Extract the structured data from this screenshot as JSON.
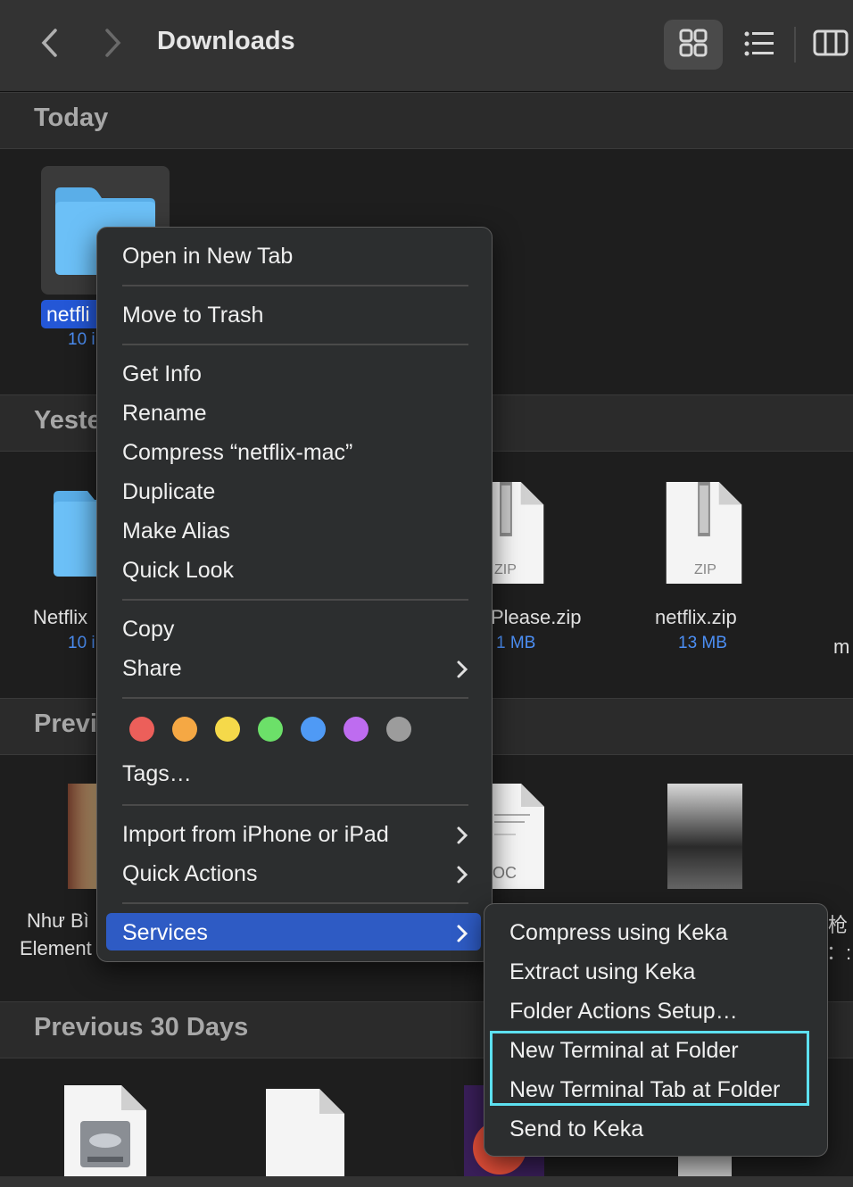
{
  "window": {
    "title": "Downloads"
  },
  "toolbar": {
    "back_icon": "chevron-left-icon",
    "forward_icon": "chevron-right-icon",
    "views": [
      "grid-view-icon",
      "list-view-icon",
      "column-view-icon"
    ]
  },
  "sections": {
    "today": "Today",
    "yesterday": "Yeste",
    "previous7": "Previ",
    "previous30": "Previous 30 Days"
  },
  "items": {
    "today_folder": {
      "name": "netfli",
      "size": "10 i"
    },
    "yesterday_folder": {
      "name": "Netflix",
      "size": "10 i"
    },
    "please_zip": {
      "name": "Please.zip",
      "size": "1 MB",
      "badge": "ZIP"
    },
    "netflix_zip": {
      "name": "netflix.zip",
      "size": "13 MB",
      "badge": "ZIP"
    },
    "edge_m": "m",
    "book1": {
      "line1": "Như Bì",
      "line2": "Element"
    },
    "doc_badge": "OC",
    "edge_cjk": "枪",
    "edge_colon": "：:"
  },
  "context_menu": {
    "open_new_tab": "Open in New Tab",
    "move_trash": "Move to Trash",
    "get_info": "Get Info",
    "rename": "Rename",
    "compress": "Compress “netflix-mac”",
    "duplicate": "Duplicate",
    "make_alias": "Make Alias",
    "quick_look": "Quick Look",
    "copy": "Copy",
    "share": "Share",
    "tags": "Tags…",
    "import": "Import from iPhone or iPad",
    "quick_actions": "Quick Actions",
    "services": "Services",
    "tag_colors": [
      "#ec5f5a",
      "#f5a844",
      "#f5d94a",
      "#6ce069",
      "#4f9af5",
      "#be6cf0",
      "#9c9c9c"
    ]
  },
  "services_menu": {
    "compress_keka": "Compress using Keka",
    "extract_keka": "Extract using Keka",
    "folder_actions": "Folder Actions Setup…",
    "new_terminal": "New Terminal at Folder",
    "new_terminal_tab": "New Terminal Tab at Folder",
    "send_keka": "Send to Keka"
  }
}
